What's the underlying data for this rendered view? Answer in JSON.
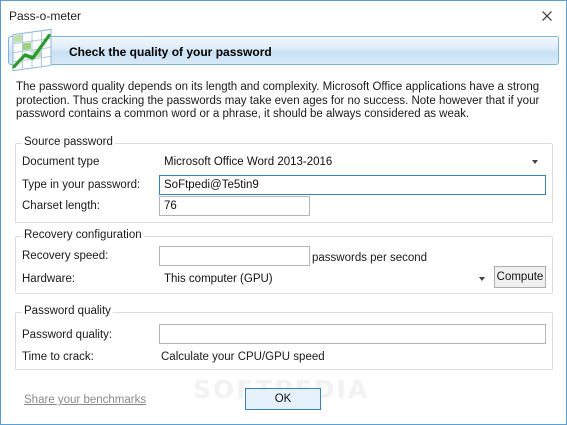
{
  "window": {
    "title": "Pass-o-meter"
  },
  "banner": {
    "title": "Check the quality of your password"
  },
  "intro": {
    "text": "The password quality depends on its length and complexity. Microsoft Office applications have a strong protection. Thus cracking the passwords may take even ages for no success. Note however that if your password contains a common word or a phrase, it should be always considered as weak."
  },
  "source": {
    "group_title": "Source password",
    "doc_type_label": "Document type",
    "doc_type_value": "Microsoft Office Word 2013-2016",
    "password_label": "Type in your password:",
    "password_value": "SoFtpedi@Te5tin9",
    "charset_label": "Charset length:",
    "charset_value": "76"
  },
  "recovery": {
    "group_title": "Recovery configuration",
    "speed_label": "Recovery speed:",
    "speed_value": "",
    "speed_unit": "passwords per second",
    "hardware_label": "Hardware:",
    "hardware_value": "This computer (GPU)",
    "compute_label": "Compute"
  },
  "quality": {
    "group_title": "Password quality",
    "quality_label": "Password quality:",
    "quality_value": "",
    "time_label": "Time to crack:",
    "time_value": "Calculate your CPU/GPU speed"
  },
  "footer": {
    "share_link": "Share your benchmarks",
    "ok_label": "OK"
  },
  "watermark": "SOFTPEDIA",
  "colors": {
    "accent": "#3c7fc1",
    "banner": "#c8e0f4",
    "link": "#8a8a8a"
  }
}
